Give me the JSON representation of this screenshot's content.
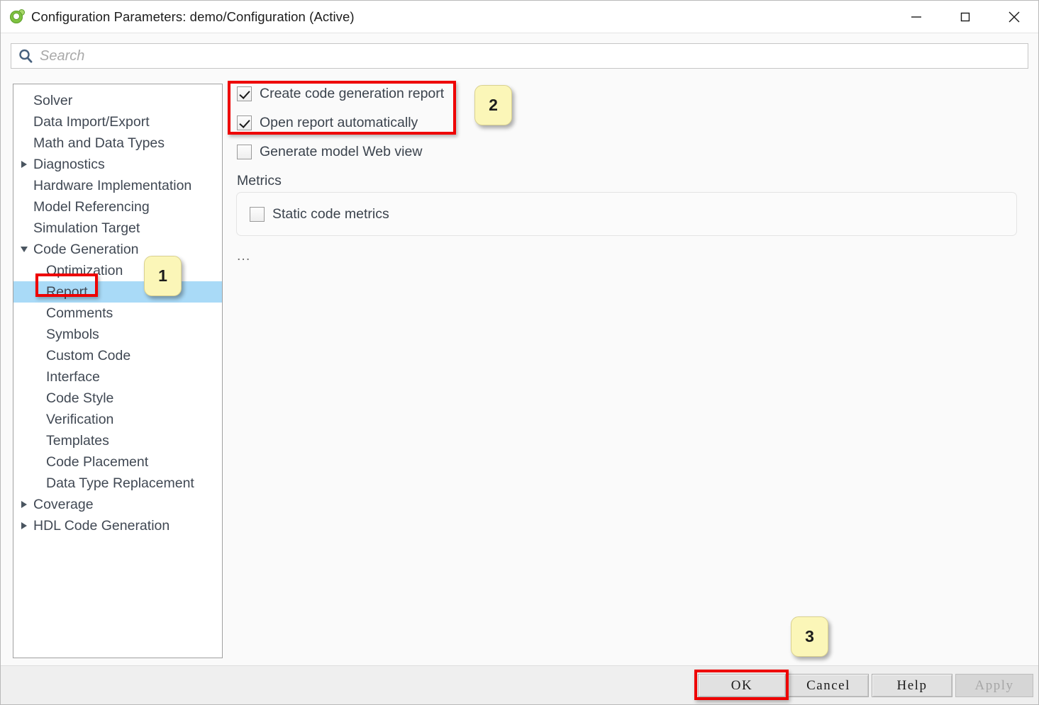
{
  "window": {
    "title": "Configuration Parameters: demo/Configuration (Active)",
    "icon": "simulink-icon",
    "minimize_label": "minimize-icon",
    "maximize_label": "maximize-icon",
    "close_label": "close-icon"
  },
  "search": {
    "placeholder": "Search",
    "value": "",
    "icon": "search-icon"
  },
  "sidebar": {
    "items": [
      {
        "label": "Solver",
        "level": 0,
        "twisty": "none",
        "selected": false
      },
      {
        "label": "Data Import/Export",
        "level": 0,
        "twisty": "none",
        "selected": false
      },
      {
        "label": "Math and Data Types",
        "level": 0,
        "twisty": "none",
        "selected": false
      },
      {
        "label": "Diagnostics",
        "level": 0,
        "twisty": "right",
        "selected": false
      },
      {
        "label": "Hardware Implementation",
        "level": 0,
        "twisty": "none",
        "selected": false
      },
      {
        "label": "Model Referencing",
        "level": 0,
        "twisty": "none",
        "selected": false
      },
      {
        "label": "Simulation Target",
        "level": 0,
        "twisty": "none",
        "selected": false
      },
      {
        "label": "Code Generation",
        "level": 0,
        "twisty": "down",
        "selected": false
      },
      {
        "label": "Optimization",
        "level": 1,
        "twisty": "none",
        "selected": false
      },
      {
        "label": "Report",
        "level": 1,
        "twisty": "none",
        "selected": true
      },
      {
        "label": "Comments",
        "level": 1,
        "twisty": "none",
        "selected": false
      },
      {
        "label": "Symbols",
        "level": 1,
        "twisty": "none",
        "selected": false
      },
      {
        "label": "Custom Code",
        "level": 1,
        "twisty": "none",
        "selected": false
      },
      {
        "label": "Interface",
        "level": 1,
        "twisty": "none",
        "selected": false
      },
      {
        "label": "Code Style",
        "level": 1,
        "twisty": "none",
        "selected": false
      },
      {
        "label": "Verification",
        "level": 1,
        "twisty": "none",
        "selected": false
      },
      {
        "label": "Templates",
        "level": 1,
        "twisty": "none",
        "selected": false
      },
      {
        "label": "Code Placement",
        "level": 1,
        "twisty": "none",
        "selected": false
      },
      {
        "label": "Data Type Replacement",
        "level": 1,
        "twisty": "none",
        "selected": false
      },
      {
        "label": "Coverage",
        "level": 0,
        "twisty": "right",
        "selected": false
      },
      {
        "label": "HDL Code Generation",
        "level": 0,
        "twisty": "right",
        "selected": false
      }
    ]
  },
  "main": {
    "checkboxes": [
      {
        "label": "Create code generation report",
        "checked": true
      },
      {
        "label": "Open report automatically",
        "checked": true
      },
      {
        "label": "Generate model Web view",
        "checked": false
      }
    ],
    "metrics_group_label": "Metrics",
    "metrics_checkbox": {
      "label": "Static code metrics",
      "checked": false
    },
    "ellipsis": "..."
  },
  "footer": {
    "buttons": [
      {
        "label": "OK",
        "disabled": false
      },
      {
        "label": "Cancel",
        "disabled": false
      },
      {
        "label": "Help",
        "disabled": false
      },
      {
        "label": "Apply",
        "disabled": true
      }
    ]
  },
  "annotations": {
    "badges": [
      {
        "number": "1"
      },
      {
        "number": "2"
      },
      {
        "number": "3"
      }
    ],
    "highlight_color": "#ee0000",
    "badge_color": "#fbf6b8",
    "selection_color": "#a9daf7"
  }
}
